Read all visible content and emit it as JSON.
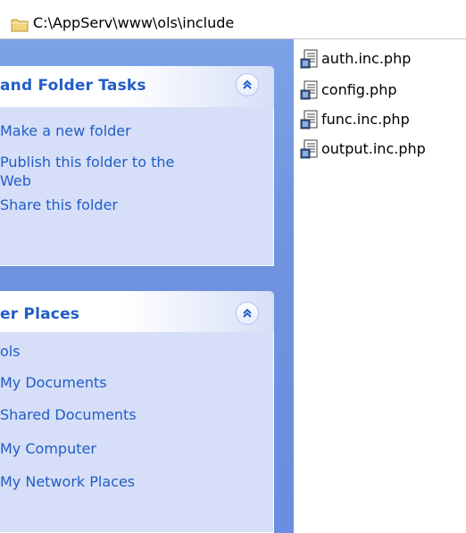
{
  "address": {
    "path": "C:\\AppServ\\www\\ols\\include",
    "icon": "folder-icon"
  },
  "task_pane": {
    "file_tasks": {
      "title": "and Folder Tasks",
      "collapse_icon": "double-chevron-up-icon",
      "links": [
        "Make a new folder",
        "Publish this folder to the",
        "Web",
        "Share this folder"
      ]
    },
    "other_places": {
      "title": "er Places",
      "collapse_icon": "double-chevron-up-icon",
      "links": [
        "ols",
        "My Documents",
        "Shared Documents",
        "My Computer",
        "My Network Places"
      ]
    }
  },
  "files": [
    {
      "name": "auth.inc.php",
      "icon": "php-file-icon"
    },
    {
      "name": "config.php",
      "icon": "php-file-icon"
    },
    {
      "name": "func.inc.php",
      "icon": "php-file-icon"
    },
    {
      "name": "output.inc.php",
      "icon": "php-file-icon"
    }
  ],
  "colors": {
    "pane_background": "#6f93df",
    "panel_body": "#d6dff7",
    "link_color": "#215dc6",
    "title_color": "#215dc6"
  }
}
